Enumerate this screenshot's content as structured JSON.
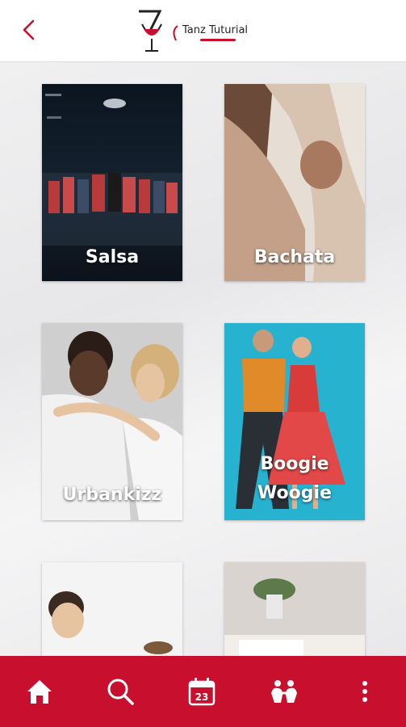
{
  "header": {
    "back_icon": "chevron-left-icon",
    "logo_text": "Tanz Tuturial",
    "logo_glyph": "7"
  },
  "cards": [
    {
      "label": "Salsa"
    },
    {
      "label": "Bachata"
    },
    {
      "label": "Urbankizz"
    },
    {
      "label_line1": "Boogie",
      "label_line2": "Woogie"
    },
    {
      "label": ""
    },
    {
      "label": ""
    }
  ],
  "bottom_nav": {
    "items": [
      "home-icon",
      "search-icon",
      "calendar-icon",
      "dancers-icon",
      "more-vertical-icon"
    ],
    "calendar_day": "23"
  },
  "colors": {
    "brand_red": "#c8102e",
    "header_bg": "#ffffff"
  }
}
